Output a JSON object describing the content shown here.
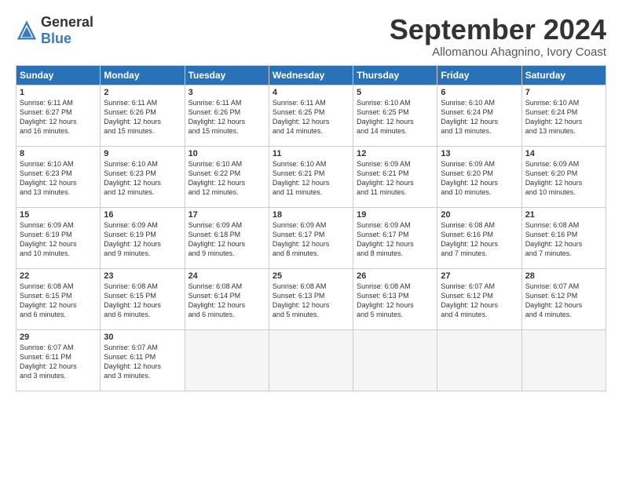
{
  "logo": {
    "general": "General",
    "blue": "Blue"
  },
  "title": "September 2024",
  "subtitle": "Allomanou Ahagnino, Ivory Coast",
  "headers": [
    "Sunday",
    "Monday",
    "Tuesday",
    "Wednesday",
    "Thursday",
    "Friday",
    "Saturday"
  ],
  "weeks": [
    [
      {
        "day": "1",
        "sunrise": "6:11 AM",
        "sunset": "6:27 PM",
        "daylight": "12 hours and 16 minutes."
      },
      {
        "day": "2",
        "sunrise": "6:11 AM",
        "sunset": "6:26 PM",
        "daylight": "12 hours and 15 minutes."
      },
      {
        "day": "3",
        "sunrise": "6:11 AM",
        "sunset": "6:26 PM",
        "daylight": "12 hours and 15 minutes."
      },
      {
        "day": "4",
        "sunrise": "6:11 AM",
        "sunset": "6:25 PM",
        "daylight": "12 hours and 14 minutes."
      },
      {
        "day": "5",
        "sunrise": "6:10 AM",
        "sunset": "6:25 PM",
        "daylight": "12 hours and 14 minutes."
      },
      {
        "day": "6",
        "sunrise": "6:10 AM",
        "sunset": "6:24 PM",
        "daylight": "12 hours and 13 minutes."
      },
      {
        "day": "7",
        "sunrise": "6:10 AM",
        "sunset": "6:24 PM",
        "daylight": "12 hours and 13 minutes."
      }
    ],
    [
      {
        "day": "8",
        "sunrise": "6:10 AM",
        "sunset": "6:23 PM",
        "daylight": "12 hours and 13 minutes."
      },
      {
        "day": "9",
        "sunrise": "6:10 AM",
        "sunset": "6:23 PM",
        "daylight": "12 hours and 12 minutes."
      },
      {
        "day": "10",
        "sunrise": "6:10 AM",
        "sunset": "6:22 PM",
        "daylight": "12 hours and 12 minutes."
      },
      {
        "day": "11",
        "sunrise": "6:10 AM",
        "sunset": "6:21 PM",
        "daylight": "12 hours and 11 minutes."
      },
      {
        "day": "12",
        "sunrise": "6:09 AM",
        "sunset": "6:21 PM",
        "daylight": "12 hours and 11 minutes."
      },
      {
        "day": "13",
        "sunrise": "6:09 AM",
        "sunset": "6:20 PM",
        "daylight": "12 hours and 10 minutes."
      },
      {
        "day": "14",
        "sunrise": "6:09 AM",
        "sunset": "6:20 PM",
        "daylight": "12 hours and 10 minutes."
      }
    ],
    [
      {
        "day": "15",
        "sunrise": "6:09 AM",
        "sunset": "6:19 PM",
        "daylight": "12 hours and 10 minutes."
      },
      {
        "day": "16",
        "sunrise": "6:09 AM",
        "sunset": "6:19 PM",
        "daylight": "12 hours and 9 minutes."
      },
      {
        "day": "17",
        "sunrise": "6:09 AM",
        "sunset": "6:18 PM",
        "daylight": "12 hours and 9 minutes."
      },
      {
        "day": "18",
        "sunrise": "6:09 AM",
        "sunset": "6:17 PM",
        "daylight": "12 hours and 8 minutes."
      },
      {
        "day": "19",
        "sunrise": "6:09 AM",
        "sunset": "6:17 PM",
        "daylight": "12 hours and 8 minutes."
      },
      {
        "day": "20",
        "sunrise": "6:08 AM",
        "sunset": "6:16 PM",
        "daylight": "12 hours and 7 minutes."
      },
      {
        "day": "21",
        "sunrise": "6:08 AM",
        "sunset": "6:16 PM",
        "daylight": "12 hours and 7 minutes."
      }
    ],
    [
      {
        "day": "22",
        "sunrise": "6:08 AM",
        "sunset": "6:15 PM",
        "daylight": "12 hours and 6 minutes."
      },
      {
        "day": "23",
        "sunrise": "6:08 AM",
        "sunset": "6:15 PM",
        "daylight": "12 hours and 6 minutes."
      },
      {
        "day": "24",
        "sunrise": "6:08 AM",
        "sunset": "6:14 PM",
        "daylight": "12 hours and 6 minutes."
      },
      {
        "day": "25",
        "sunrise": "6:08 AM",
        "sunset": "6:13 PM",
        "daylight": "12 hours and 5 minutes."
      },
      {
        "day": "26",
        "sunrise": "6:08 AM",
        "sunset": "6:13 PM",
        "daylight": "12 hours and 5 minutes."
      },
      {
        "day": "27",
        "sunrise": "6:07 AM",
        "sunset": "6:12 PM",
        "daylight": "12 hours and 4 minutes."
      },
      {
        "day": "28",
        "sunrise": "6:07 AM",
        "sunset": "6:12 PM",
        "daylight": "12 hours and 4 minutes."
      }
    ],
    [
      {
        "day": "29",
        "sunrise": "6:07 AM",
        "sunset": "6:11 PM",
        "daylight": "12 hours and 3 minutes."
      },
      {
        "day": "30",
        "sunrise": "6:07 AM",
        "sunset": "6:11 PM",
        "daylight": "12 hours and 3 minutes."
      },
      null,
      null,
      null,
      null,
      null
    ]
  ]
}
